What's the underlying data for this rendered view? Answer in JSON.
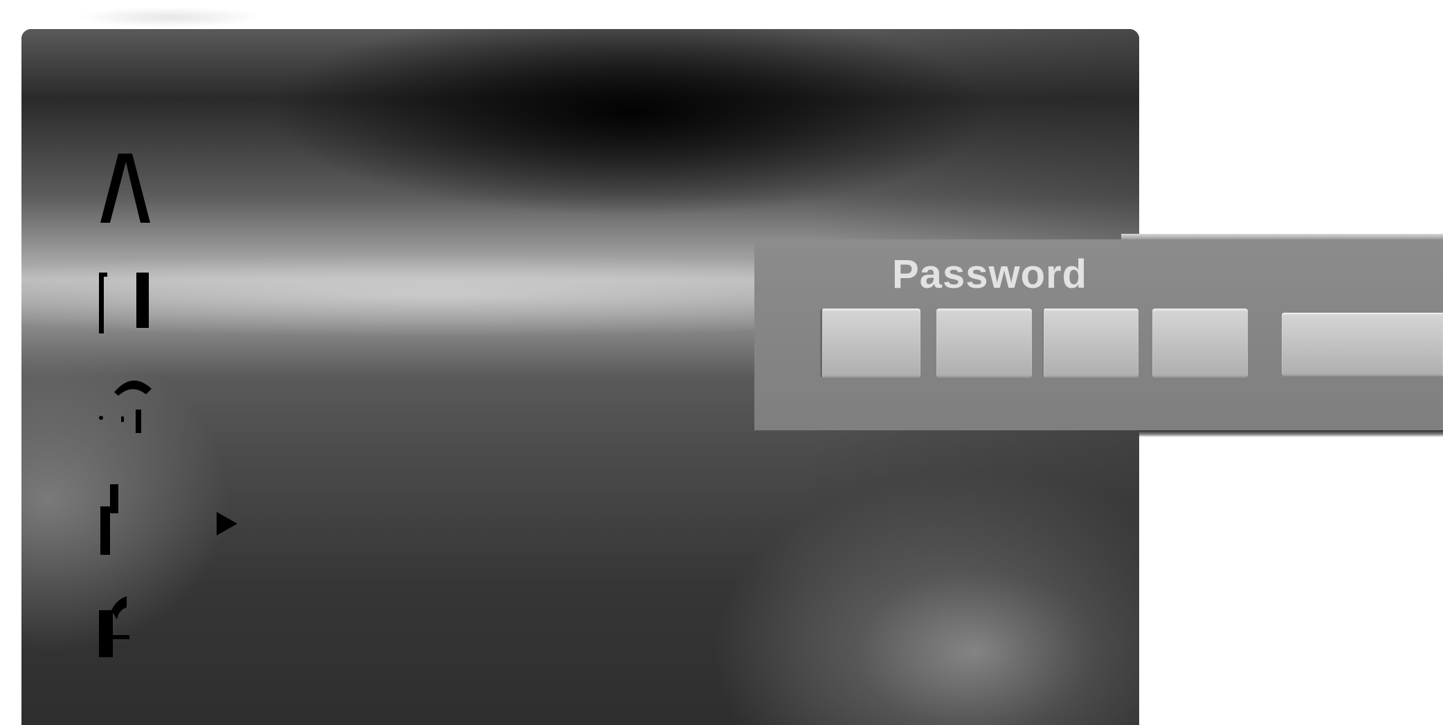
{
  "password_dialog": {
    "title": "Password",
    "digits": [
      "",
      "",
      "",
      ""
    ],
    "confirm_label": ""
  },
  "menu": {
    "items": [
      {
        "glyph_icon": "letter-a-glyph-icon"
      },
      {
        "glyph_icon": "bracket-glyph-icon"
      },
      {
        "glyph_icon": "hook-glyph-icon"
      },
      {
        "glyph_icon": "f-glyph-icon",
        "selected": true
      },
      {
        "glyph_icon": "r-glyph-icon"
      }
    ],
    "cursor_icon": "right-triangle-icon"
  },
  "colors": {
    "panel_dark": "#2a2a2a",
    "panel_highlight": "#b8b8b8",
    "dialog_bg": "#858585",
    "dialog_title": "#e2e2e2",
    "input_box": "#c4c4c4"
  }
}
